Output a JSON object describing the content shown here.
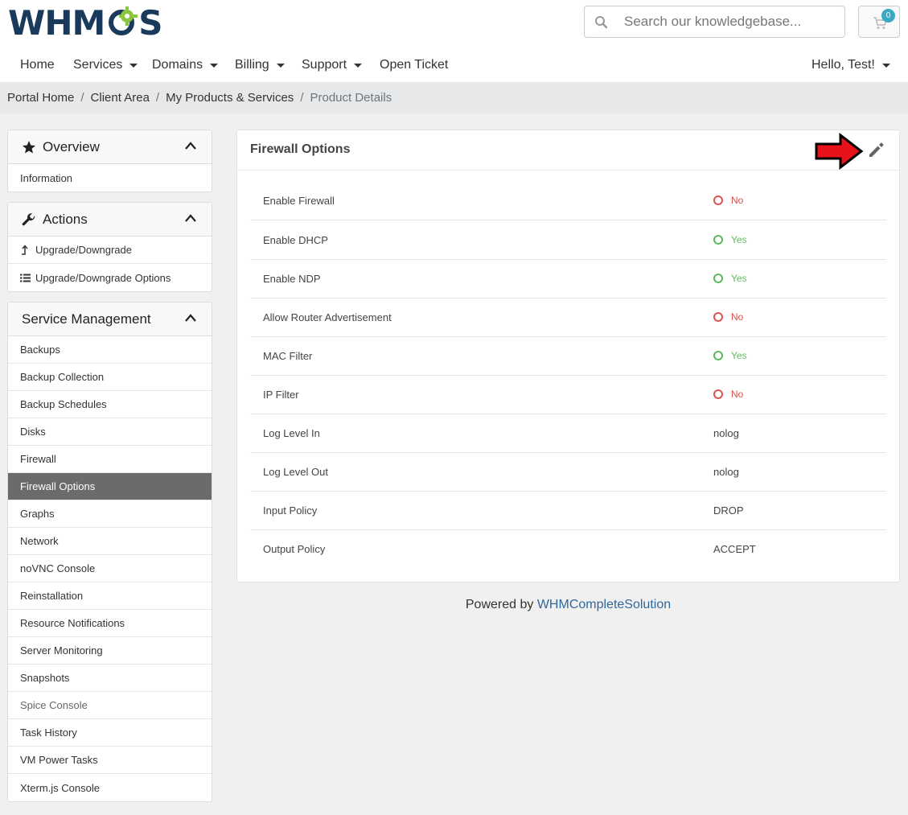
{
  "header": {
    "logo_text_left": "WHM",
    "logo_text_right": "S",
    "search_placeholder": "Search our knowledgebase...",
    "cart_count": "0",
    "colors": {
      "logo": "#1a3a5c",
      "gear": "#8cc63f",
      "badge": "#3aa9c4"
    }
  },
  "nav": {
    "items": [
      {
        "label": "Home"
      },
      {
        "label": "Services"
      },
      {
        "label": "Domains"
      },
      {
        "label": "Billing"
      },
      {
        "label": "Support"
      },
      {
        "label": "Open Ticket"
      }
    ],
    "user": "Hello, Test!"
  },
  "breadcrumb": [
    "Portal Home",
    "Client Area",
    "My Products & Services",
    "Product Details"
  ],
  "sidebar": {
    "overview": {
      "title": "Overview",
      "icon": "star-icon",
      "items": [
        "Information"
      ]
    },
    "actions": {
      "title": "Actions",
      "icon": "wrench-icon",
      "items": [
        "Upgrade/Downgrade",
        "Upgrade/Downgrade Options"
      ]
    },
    "service_management": {
      "title": "Service Management",
      "items": [
        "Backups",
        "Backup Collection",
        "Backup Schedules",
        "Disks",
        "Firewall",
        "Firewall Options",
        "Graphs",
        "Network",
        "noVNC Console",
        "Reinstallation",
        "Resource Notifications",
        "Server Monitoring",
        "Snapshots",
        "Spice Console",
        "Task History",
        "VM Power Tasks",
        "Xterm.js Console"
      ],
      "active": "Firewall Options"
    }
  },
  "card": {
    "title": "Firewall Options",
    "rows": [
      {
        "label": "Enable Firewall",
        "value": "No",
        "status": "no"
      },
      {
        "label": "Enable DHCP",
        "value": "Yes",
        "status": "yes"
      },
      {
        "label": "Enable NDP",
        "value": "Yes",
        "status": "yes"
      },
      {
        "label": "Allow Router Advertisement",
        "value": "No",
        "status": "no"
      },
      {
        "label": "MAC Filter",
        "value": "Yes",
        "status": "yes"
      },
      {
        "label": "IP Filter",
        "value": "No",
        "status": "no"
      },
      {
        "label": "Log Level In",
        "value": "nolog"
      },
      {
        "label": "Log Level Out",
        "value": "nolog"
      },
      {
        "label": "Input Policy",
        "value": "DROP"
      },
      {
        "label": "Output Policy",
        "value": "ACCEPT"
      }
    ],
    "colors": {
      "no": "#d9534f",
      "yes": "#5cb85c"
    }
  },
  "footer": {
    "prefix": "Powered by",
    "link": "WHMCompleteSolution"
  }
}
